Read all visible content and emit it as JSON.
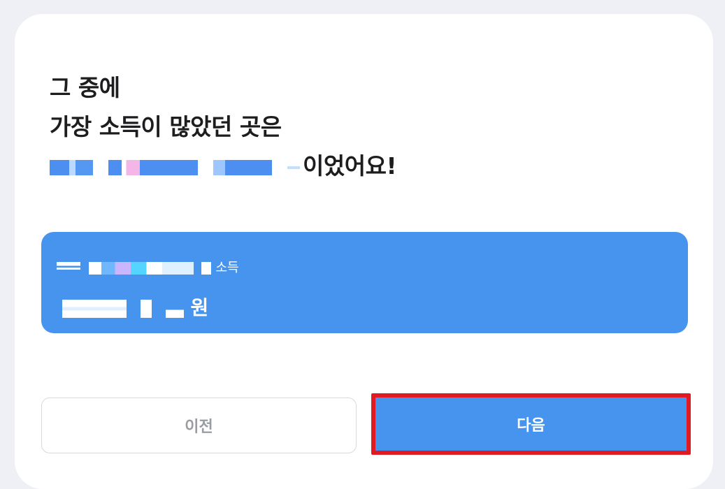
{
  "heading": {
    "line1": "그 중에",
    "line2": "가장 소득이 많았던 곳은",
    "line3_suffix": "이었어요!"
  },
  "info_box": {
    "label_suffix": "소득",
    "value_suffix": "원"
  },
  "buttons": {
    "prev_label": "이전",
    "next_label": "다음"
  },
  "colors": {
    "accent": "#4794ee",
    "highlight_border": "#e01b24",
    "background": "#eef0f6"
  }
}
